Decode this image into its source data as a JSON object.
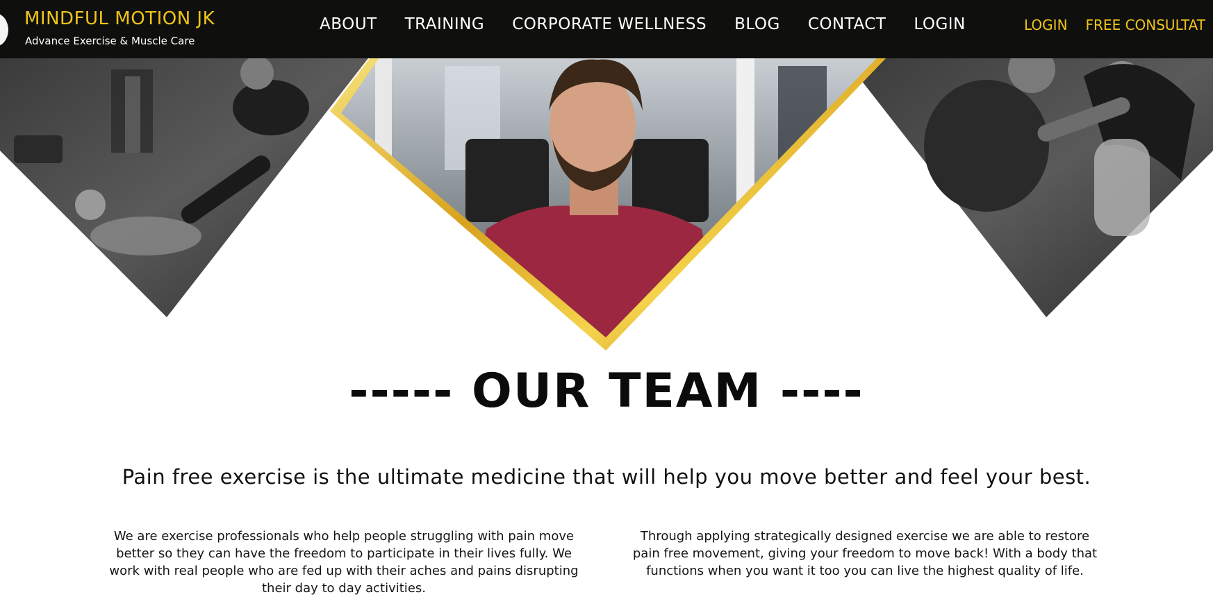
{
  "header": {
    "brand_title": "MINDFUL MOTION JK",
    "brand_subtitle": "Advance Exercise & Muscle Care",
    "nav": [
      {
        "label": "ABOUT"
      },
      {
        "label": "TRAINING"
      },
      {
        "label": "CORPORATE WELLNESS"
      },
      {
        "label": "BLOG"
      },
      {
        "label": "CONTACT"
      },
      {
        "label": "LOGIN"
      }
    ],
    "nav_right": [
      {
        "label": "LOGIN"
      },
      {
        "label": "FREE CONSULTAT"
      }
    ]
  },
  "hero": {
    "images": [
      {
        "name": "therapist-stretching-client-photo"
      },
      {
        "name": "trainer-portrait-photo"
      },
      {
        "name": "therapist-assessing-client-photo"
      }
    ]
  },
  "section": {
    "title": "----- OUR TEAM ----",
    "tagline": "Pain free exercise is the ultimate medicine that will help you move better and feel your best.",
    "paragraph_left": "We are exercise professionals who help people struggling with pain move better so they can have the freedom to participate in their lives fully. We work with real people who are fed up with their aches and pains disrupting their day to day activities.",
    "paragraph_right": "Through applying strategically designed exercise we are able to restore pain free movement, giving your freedom to move back! With a body that functions when you want it too you can live the highest quality of life."
  },
  "colors": {
    "accent": "#f0c419",
    "header_bg": "#0f0f0d",
    "text_dark": "#0b0b0b"
  }
}
